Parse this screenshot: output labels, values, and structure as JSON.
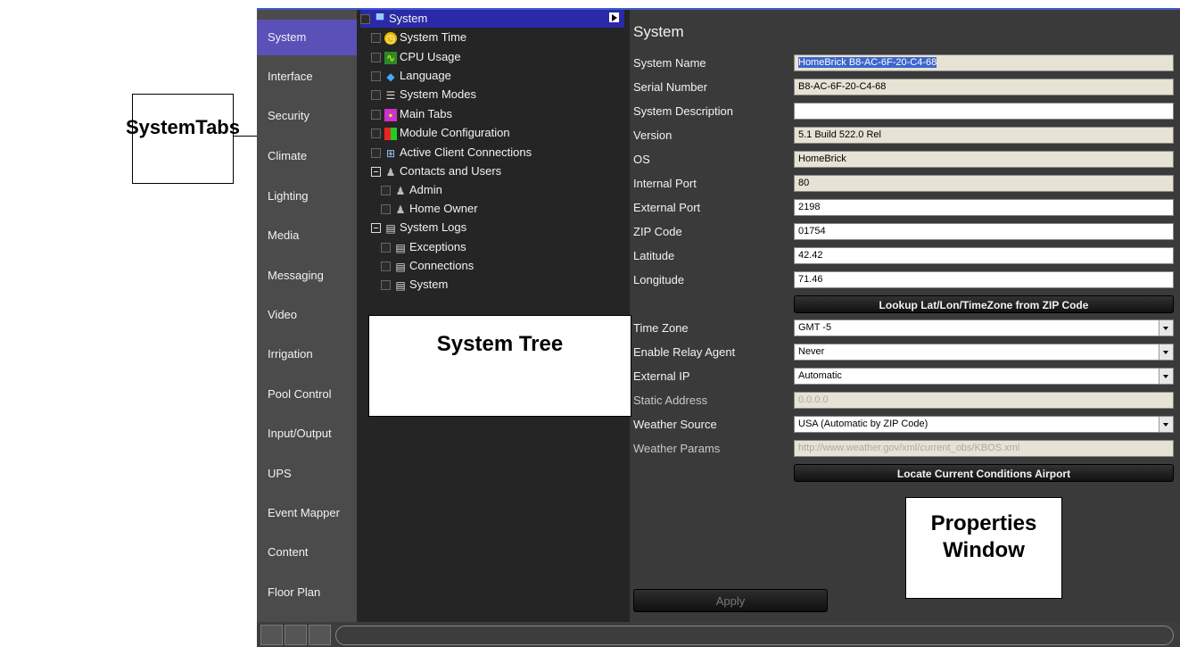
{
  "callouts": {
    "tabs": "SystemTabs",
    "tree": "System Tree",
    "props_line1": "Properties",
    "props_line2": "Window"
  },
  "tabs": [
    "System",
    "Interface",
    "Security",
    "Climate",
    "Lighting",
    "Media",
    "Messaging",
    "Video",
    "Irrigation",
    "Pool Control",
    "Input/Output",
    "UPS",
    "Event Mapper",
    "Content",
    "Floor Plan"
  ],
  "active_tab": "System",
  "tree": {
    "root": "System",
    "items": [
      {
        "label": "System Time",
        "icon": "clock-icon"
      },
      {
        "label": "CPU Usage",
        "icon": "cpu-graph-icon"
      },
      {
        "label": "Language",
        "icon": "language-icon"
      },
      {
        "label": "System Modes",
        "icon": "modes-icon"
      },
      {
        "label": "Main Tabs",
        "icon": "tabs-icon"
      },
      {
        "label": "Module Configuration",
        "icon": "module-icon"
      },
      {
        "label": "Active Client Connections",
        "icon": "connections-icon"
      }
    ],
    "contacts": {
      "label": "Contacts and Users",
      "children": [
        "Admin",
        "Home Owner"
      ]
    },
    "logs": {
      "label": "System Logs",
      "children": [
        "Exceptions",
        "Connections",
        "System"
      ]
    }
  },
  "props": {
    "title": "System",
    "system_name_label": "System Name",
    "system_name": "HomeBrick B8-AC-6F-20-C4-68",
    "serial_label": "Serial Number",
    "serial": "B8-AC-6F-20-C4-68",
    "description_label": "System Description",
    "description": "",
    "version_label": "Version",
    "version": "5.1 Build 522.0 Rel",
    "os_label": "OS",
    "os": "HomeBrick",
    "internal_port_label": "Internal Port",
    "internal_port": "80",
    "external_port_label": "External Port",
    "external_port": "2198",
    "zip_label": "ZIP Code",
    "zip": "01754",
    "latitude_label": "Latitude",
    "latitude": "42.42",
    "longitude_label": "Longitude",
    "longitude": "71.46",
    "lookup_button": "Lookup Lat/Lon/TimeZone from ZIP Code",
    "timezone_label": "Time Zone",
    "timezone": "GMT -5",
    "relay_label": "Enable Relay Agent",
    "relay": "Never",
    "external_ip_label": "External IP",
    "external_ip": "Automatic",
    "static_address_label": "Static Address",
    "static_address": "0.0.0.0",
    "weather_source_label": "Weather Source",
    "weather_source": "USA (Automatic by ZIP Code)",
    "weather_params_label": "Weather Params",
    "weather_params": "http://www.weather.gov/xml/current_obs/KBOS.xml",
    "airport_button": "Locate Current Conditions Airport",
    "apply_button": "Apply"
  }
}
